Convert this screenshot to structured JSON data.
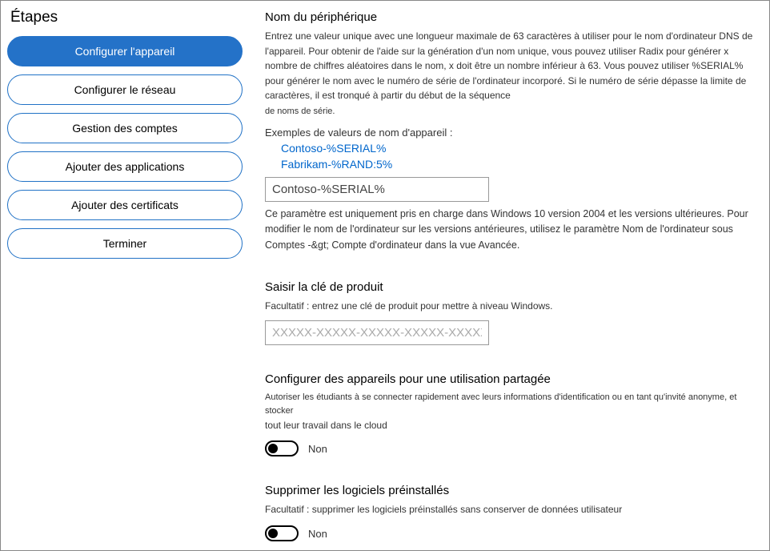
{
  "sidebar": {
    "title": "Étapes",
    "steps": [
      {
        "label": "Configurer l'appareil",
        "active": true
      },
      {
        "label": "Configurer le réseau",
        "active": false
      },
      {
        "label": "Gestion des comptes",
        "active": false
      },
      {
        "label": "Ajouter des applications",
        "active": false
      },
      {
        "label": "Ajouter des certificats",
        "active": false
      },
      {
        "label": "Terminer",
        "active": false
      }
    ]
  },
  "device_name": {
    "title": "Nom du périphérique",
    "description": "Entrez une valeur unique avec une longueur maximale de 63 caractères à utiliser pour le nom d'ordinateur DNS de l'appareil. Pour obtenir de l'aide sur la génération d'un nom unique, vous pouvez utiliser Radix pour générer x nombre de chiffres aléatoires dans le nom, x doit être un nombre inférieur à 63. Vous pouvez utiliser %SERIAL% pour générer le nom avec le numéro de série de l'ordinateur incorporé. Si le numéro de série dépasse la limite de caractères, il est tronqué à partir du début de la séquence",
    "description_tail": "de noms de série.",
    "examples_label": "Exemples de valeurs de nom d'appareil :",
    "example1": "Contoso-%SERIAL%",
    "example2": "Fabrikam-%RAND:5%",
    "input_value": "Contoso-%SERIAL%",
    "note": "Ce paramètre est uniquement pris en charge dans Windows 10 version 2004 et les versions ultérieures. Pour modifier le nom de l'ordinateur sur les versions antérieures, utilisez le paramètre Nom de l'ordinateur sous Comptes -&gt; Compte d'ordinateur dans la vue Avancée."
  },
  "product_key": {
    "title": "Saisir la clé de produit",
    "description": "Facultatif : entrez une clé de produit pour mettre à niveau Windows.",
    "placeholder": "XXXXX-XXXXX-XXXXX-XXXXX-XXXXX"
  },
  "shared_use": {
    "title": "Configurer des appareils pour une utilisation partagée",
    "description_small": "Autoriser les étudiants à se connecter rapidement avec leurs informations d'identification ou en tant qu'invité anonyme, et stocker",
    "description_tail": "tout leur travail dans le cloud",
    "toggle_label": "Non"
  },
  "remove_preinstalled": {
    "title": "Supprimer les logiciels préinstallés",
    "description": "Facultatif : supprimer les logiciels préinstallés sans conserver de données utilisateur",
    "toggle_label": "Non"
  }
}
